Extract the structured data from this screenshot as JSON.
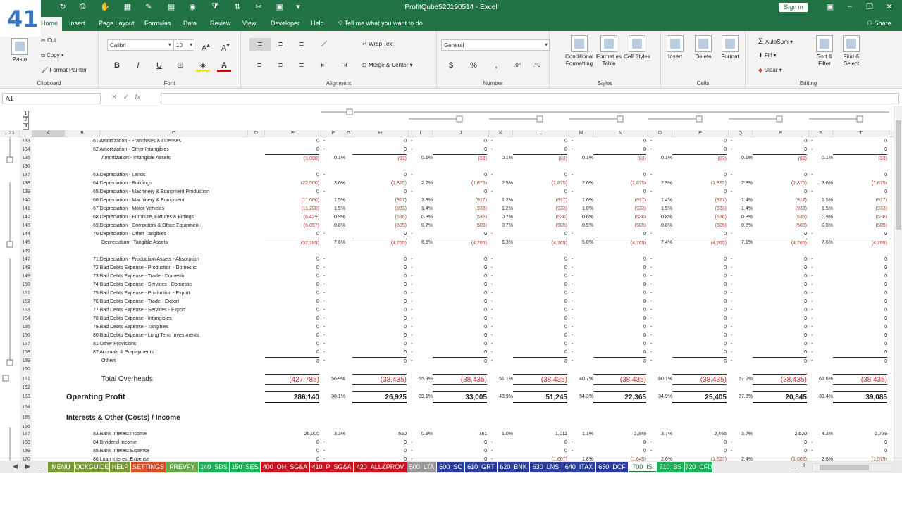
{
  "window": {
    "title": "ProfitQube520190514  -  Excel",
    "sign_in": "Sign in"
  },
  "logo": {
    "text": "41"
  },
  "menu": {
    "tabs": [
      "Home",
      "Insert",
      "Page Layout",
      "Formulas",
      "Data",
      "Review",
      "View",
      "Developer",
      "Help"
    ],
    "tell_me": "Tell me what you want to do",
    "share": "Share"
  },
  "ribbon": {
    "clipboard": {
      "label": "Clipboard",
      "paste": "Paste",
      "cut": "Cut",
      "copy": "Copy",
      "format_painter": "Format Painter"
    },
    "font": {
      "label": "Font",
      "font_name": "Calibri",
      "font_size": "10"
    },
    "alignment": {
      "label": "Alignment",
      "wrap_text": "Wrap Text",
      "merge_center": "Merge & Center"
    },
    "number": {
      "label": "Number",
      "format": "General"
    },
    "styles": {
      "label": "Styles",
      "conditional": "Conditional Formatting",
      "format_table": "Format as Table",
      "cell_styles": "Cell Styles"
    },
    "cells": {
      "label": "Cells",
      "insert": "Insert",
      "delete": "Delete",
      "format": "Format"
    },
    "editing": {
      "label": "Editing",
      "autosum": "AutoSum",
      "fill": "Fill",
      "clear": "Clear",
      "sort_filter": "Sort & Filter",
      "find_select": "Find & Select"
    }
  },
  "formula_bar": {
    "name_box": "A1",
    "formula": ""
  },
  "outline_levels": [
    "1",
    "2",
    "3"
  ],
  "columns": [
    "A",
    "B",
    "C",
    "D",
    "E",
    "F",
    "G",
    "H",
    "I",
    "J",
    "K",
    "L",
    "M",
    "N",
    "O",
    "P",
    "Q",
    "R",
    "S",
    "T"
  ],
  "rows": [
    {
      "n": "133",
      "label": "61  Amortization - Franchises & Licenses",
      "vals": [
        "0",
        "-",
        "0",
        "-",
        "0",
        "-",
        "0",
        "-",
        "0",
        "-",
        "0",
        "-",
        "0",
        "-",
        "0"
      ]
    },
    {
      "n": "134",
      "label": "62  Amortization - Other Intangibles",
      "vals": [
        "0",
        "-",
        "0",
        "-",
        "0",
        "-",
        "0",
        "-",
        "0",
        "-",
        "0",
        "-",
        "0",
        "-",
        "0"
      ]
    },
    {
      "n": "135",
      "label": "Amortization - Intangible Assets",
      "vals": [
        "(1,000)",
        "0.1%",
        "(83)",
        "0.1%",
        "(83)",
        "0.1%",
        "(83)",
        "0.1%",
        "(83)",
        "0.1%",
        "(83)",
        "0.1%",
        "(83)",
        "0.1%",
        "(83)"
      ],
      "sub": true
    },
    {
      "n": "136",
      "label": "",
      "vals": []
    },
    {
      "n": "137",
      "label": "63  Depreciation - Lands",
      "vals": [
        "0",
        "-",
        "0",
        "-",
        "0",
        "-",
        "0",
        "-",
        "0",
        "-",
        "0",
        "-",
        "0",
        "-",
        "0"
      ]
    },
    {
      "n": "138",
      "label": "64  Depreciation - Buildings",
      "vals": [
        "(22,500)",
        "3.0%",
        "(1,875)",
        "2.7%",
        "(1,875)",
        "2.5%",
        "(1,875)",
        "2.0%",
        "(1,875)",
        "2.9%",
        "(1,875)",
        "2.8%",
        "(1,875)",
        "3.0%",
        "(1,875)"
      ]
    },
    {
      "n": "139",
      "label": "65  Depreciation - Machinery & Equipment Production",
      "vals": [
        "0",
        "-",
        "0",
        "-",
        "0",
        "-",
        "0",
        "-",
        "0",
        "-",
        "0",
        "-",
        "0",
        "-",
        "0"
      ]
    },
    {
      "n": "140",
      "label": "66  Depreciation - Machinery & Equipment",
      "vals": [
        "(11,000)",
        "1.5%",
        "(917)",
        "1.3%",
        "(917)",
        "1.2%",
        "(917)",
        "1.0%",
        "(917)",
        "1.4%",
        "(917)",
        "1.4%",
        "(917)",
        "1.5%",
        "(917)"
      ]
    },
    {
      "n": "141",
      "label": "67  Depreciation - Motor Vehicles",
      "vals": [
        "(11,200)",
        "1.5%",
        "(933)",
        "1.4%",
        "(933)",
        "1.2%",
        "(933)",
        "1.0%",
        "(933)",
        "1.5%",
        "(933)",
        "1.4%",
        "(933)",
        "1.5%",
        "(933)"
      ]
    },
    {
      "n": "142",
      "label": "68  Depreciation - Furniture, Fixtures & Fittings",
      "vals": [
        "(6,429)",
        "0.9%",
        "(536)",
        "0.8%",
        "(536)",
        "0.7%",
        "(536)",
        "0.6%",
        "(536)",
        "0.8%",
        "(536)",
        "0.8%",
        "(536)",
        "0.9%",
        "(536)"
      ]
    },
    {
      "n": "143",
      "label": "69  Depreciation - Computers & Office Equipment",
      "vals": [
        "(6,057)",
        "0.8%",
        "(505)",
        "0.7%",
        "(505)",
        "0.7%",
        "(505)",
        "0.5%",
        "(505)",
        "0.8%",
        "(505)",
        "0.8%",
        "(505)",
        "0.8%",
        "(505)"
      ]
    },
    {
      "n": "144",
      "label": "70  Depreciation - Other Tangibles",
      "vals": [
        "0",
        "-",
        "0",
        "-",
        "0",
        "-",
        "0",
        "-",
        "0",
        "-",
        "0",
        "-",
        "0",
        "-",
        "0"
      ]
    },
    {
      "n": "145",
      "label": "Depreciation - Tangible Assets",
      "vals": [
        "(57,185)",
        "7.6%",
        "(4,765)",
        "6.9%",
        "(4,765)",
        "6.3%",
        "(4,765)",
        "5.0%",
        "(4,765)",
        "7.4%",
        "(4,765)",
        "7.1%",
        "(4,765)",
        "7.6%",
        "(4,765)"
      ],
      "sub": true
    },
    {
      "n": "146",
      "label": "",
      "vals": []
    },
    {
      "n": "147",
      "label": "71  Depreciation - Production Assets - Absorption",
      "vals": [
        "0",
        "-",
        "0",
        "-",
        "0",
        "-",
        "0",
        "-",
        "0",
        "-",
        "0",
        "-",
        "0",
        "-",
        "0"
      ]
    },
    {
      "n": "148",
      "label": "72  Bad Debts Expense - Production - Domestic",
      "vals": [
        "0",
        "-",
        "0",
        "-",
        "0",
        "-",
        "0",
        "-",
        "0",
        "-",
        "0",
        "-",
        "0",
        "-",
        "0"
      ]
    },
    {
      "n": "149",
      "label": "73  Bad Debts Expense - Trade - Domestic",
      "vals": [
        "0",
        "-",
        "0",
        "-",
        "0",
        "-",
        "0",
        "-",
        "0",
        "-",
        "0",
        "-",
        "0",
        "-",
        "0"
      ]
    },
    {
      "n": "150",
      "label": "74  Bad Debts Expense - Services - Domestic",
      "vals": [
        "0",
        "-",
        "0",
        "-",
        "0",
        "-",
        "0",
        "-",
        "0",
        "-",
        "0",
        "-",
        "0",
        "-",
        "0"
      ]
    },
    {
      "n": "151",
      "label": "75  Bad Debts Expense - Production - Export",
      "vals": [
        "0",
        "-",
        "0",
        "-",
        "0",
        "-",
        "0",
        "-",
        "0",
        "-",
        "0",
        "-",
        "0",
        "-",
        "0"
      ]
    },
    {
      "n": "152",
      "label": "76  Bad Debts Expense - Trade - Export",
      "vals": [
        "0",
        "-",
        "0",
        "-",
        "0",
        "-",
        "0",
        "-",
        "0",
        "-",
        "0",
        "-",
        "0",
        "-",
        "0"
      ]
    },
    {
      "n": "153",
      "label": "77  Bad Debts Expense - Services - Export",
      "vals": [
        "0",
        "-",
        "0",
        "-",
        "0",
        "-",
        "0",
        "-",
        "0",
        "-",
        "0",
        "-",
        "0",
        "-",
        "0"
      ]
    },
    {
      "n": "154",
      "label": "78  Bad Debts Expense - Intangibles",
      "vals": [
        "0",
        "-",
        "0",
        "-",
        "0",
        "-",
        "0",
        "-",
        "0",
        "-",
        "0",
        "-",
        "0",
        "-",
        "0"
      ]
    },
    {
      "n": "155",
      "label": "79  Bad Debts Expense - Tangibles",
      "vals": [
        "0",
        "-",
        "0",
        "-",
        "0",
        "-",
        "0",
        "-",
        "0",
        "-",
        "0",
        "-",
        "0",
        "-",
        "0"
      ]
    },
    {
      "n": "156",
      "label": "80  Bad Debts Expense - Long Term Investments",
      "vals": [
        "0",
        "-",
        "0",
        "-",
        "0",
        "-",
        "0",
        "-",
        "0",
        "-",
        "0",
        "-",
        "0",
        "-",
        "0"
      ]
    },
    {
      "n": "157",
      "label": "81  Other Provisions",
      "vals": [
        "0",
        "-",
        "0",
        "-",
        "0",
        "-",
        "0",
        "-",
        "0",
        "-",
        "0",
        "-",
        "0",
        "-",
        "0"
      ]
    },
    {
      "n": "158",
      "label": "82  Accruals & Prepayments",
      "vals": [
        "0",
        "-",
        "0",
        "-",
        "0",
        "-",
        "0",
        "-",
        "0",
        "-",
        "0",
        "-",
        "0",
        "-",
        "0"
      ]
    },
    {
      "n": "159",
      "label": "Others",
      "vals": [
        "0",
        "-",
        "0",
        "-",
        "0",
        "-",
        "0",
        "-",
        "0",
        "-",
        "0",
        "-",
        "0",
        "-",
        "0"
      ],
      "sub": true
    },
    {
      "n": "160",
      "label": "",
      "vals": []
    }
  ],
  "total_overheads": {
    "n": "161",
    "label": "Total Overheads",
    "vals": [
      "(427,785)",
      "56.9%",
      "(38,435)",
      "55.9%",
      "(38,435)",
      "51.1%",
      "(38,435)",
      "40.7%",
      "(38,435)",
      "60.1%",
      "(38,435)",
      "57.2%",
      "(38,435)",
      "61.6%",
      "(38,435)"
    ]
  },
  "row162": {
    "n": "162"
  },
  "operating_profit": {
    "n": "163",
    "label": "Operating Profit",
    "vals": [
      "286,140",
      "38.1%",
      "26,925",
      "39.1%",
      "33,005",
      "43.9%",
      "51,245",
      "54.3%",
      "22,365",
      "34.9%",
      "25,405",
      "37.8%",
      "20,845",
      "33.4%",
      "39,085"
    ]
  },
  "row164": {
    "n": "164"
  },
  "interests_header": {
    "n": "165",
    "label": "Interests & Other (Costs) / Income"
  },
  "row166": {
    "n": "166"
  },
  "rows_bottom": [
    {
      "n": "167",
      "label": "83  Bank Interest Income",
      "vals": [
        "25,000",
        "3.3%",
        "650",
        "0.9%",
        "781",
        "1.0%",
        "1,011",
        "1.1%",
        "2,349",
        "3.7%",
        "2,466",
        "3.7%",
        "2,620",
        "4.2%",
        "2,739"
      ]
    },
    {
      "n": "168",
      "label": "84  Dividend Income",
      "vals": [
        "0",
        "-",
        "0",
        "-",
        "0",
        "-",
        "0",
        "-",
        "0",
        "-",
        "0",
        "-",
        "0",
        "-",
        "0"
      ]
    },
    {
      "n": "169",
      "label": "85  Bank Interest Expense",
      "vals": [
        "0",
        "-",
        "0",
        "-",
        "0",
        "-",
        "0",
        "-",
        "0",
        "-",
        "0",
        "-",
        "0",
        "-",
        "0"
      ]
    },
    {
      "n": "170",
      "label": "86  Loan Interest Expense",
      "vals": [
        "0",
        "-",
        "0",
        "-",
        "0",
        "-",
        "(1,667)",
        "1.8%",
        "(1,645)",
        "2.6%",
        "(1,623)",
        "2.4%",
        "(1,602)",
        "2.6%",
        "(1,579)"
      ]
    }
  ],
  "sheet_tabs": [
    {
      "name": "MENU",
      "color": "#7a9a3a"
    },
    {
      "name": "QCKGUIDE",
      "color": "#7a9a3a"
    },
    {
      "name": "HELP",
      "color": "#7a9a3a"
    },
    {
      "name": "SETTINGS",
      "color": "#d0502a"
    },
    {
      "name": "PREVFY",
      "color": "#6aa84f"
    },
    {
      "name": "140_SDS",
      "color": "#1fae5a"
    },
    {
      "name": "150_SES",
      "color": "#1fae5a"
    },
    {
      "name": "400_OH_SG&A",
      "color": "#c8141e"
    },
    {
      "name": "410_P_SG&A",
      "color": "#c8141e"
    },
    {
      "name": "420_ALL&PROV",
      "color": "#c8141e"
    },
    {
      "name": "500_LTA",
      "color": "#999999"
    },
    {
      "name": "600_SC",
      "color": "#2b3f9a"
    },
    {
      "name": "610_GRT",
      "color": "#2b3f9a"
    },
    {
      "name": "620_BNK",
      "color": "#2b3f9a"
    },
    {
      "name": "630_LNS",
      "color": "#2b3f9a"
    },
    {
      "name": "640_ITAX",
      "color": "#2b3f9a"
    },
    {
      "name": "650_DCF",
      "color": "#2b3f9a"
    },
    {
      "name": "700_IS",
      "color": "#1fae5a",
      "active": true
    },
    {
      "name": "710_BS",
      "color": "#1fae5a"
    },
    {
      "name": "720_CFD",
      "color": "#1fae5a"
    }
  ],
  "tab_nav": {
    "more": "...",
    "add": "+"
  }
}
